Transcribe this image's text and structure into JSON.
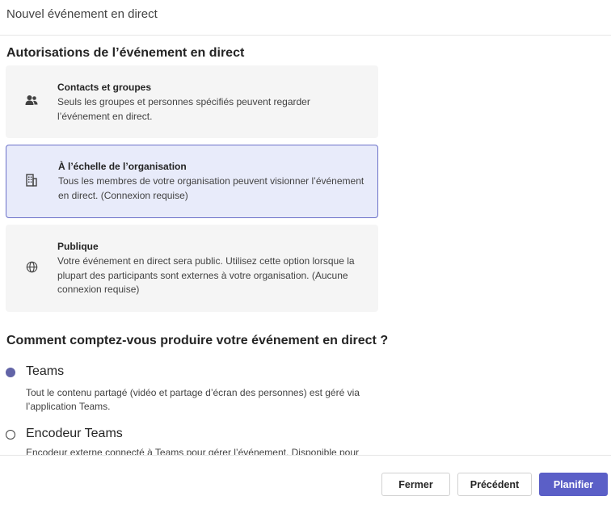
{
  "header": {
    "title": "Nouvel événement en direct"
  },
  "permissions": {
    "title": "Autorisations de l’événement en direct",
    "options": [
      {
        "icon": "people-icon",
        "title": "Contacts et groupes",
        "description": "Seuls les groupes et personnes spécifiés peuvent regarder l’événement en direct.",
        "selected": false
      },
      {
        "icon": "building-icon",
        "title": "À l’échelle de l’organisation",
        "description": "Tous les membres de votre organisation peuvent visionner l’événement en direct. (Connexion requise)",
        "selected": true
      },
      {
        "icon": "globe-icon",
        "title": "Publique",
        "description": "Votre événement en direct sera public. Utilisez cette option lorsque la plupart des participants sont externes à votre organisation. (Aucune connexion requise)",
        "selected": false
      }
    ]
  },
  "production": {
    "title": "Comment comptez-vous produire votre événement en direct ?",
    "options": [
      {
        "label": "Teams",
        "description": "Tout le contenu partagé (vidéo et partage d’écran des personnes) est géré via l’application Teams.",
        "checked": true
      },
      {
        "label": "Encodeur Teams",
        "description": "Encodeur externe connecté à Teams pour gérer l’événement. Disponible pour",
        "checked": false
      }
    ]
  },
  "footer": {
    "close_label": "Fermer",
    "previous_label": "Précédent",
    "schedule_label": "Planifier"
  },
  "colors": {
    "accent": "#5b5fc7",
    "selected_card_bg": "#e8ebfa",
    "card_bg": "#f5f5f5"
  }
}
